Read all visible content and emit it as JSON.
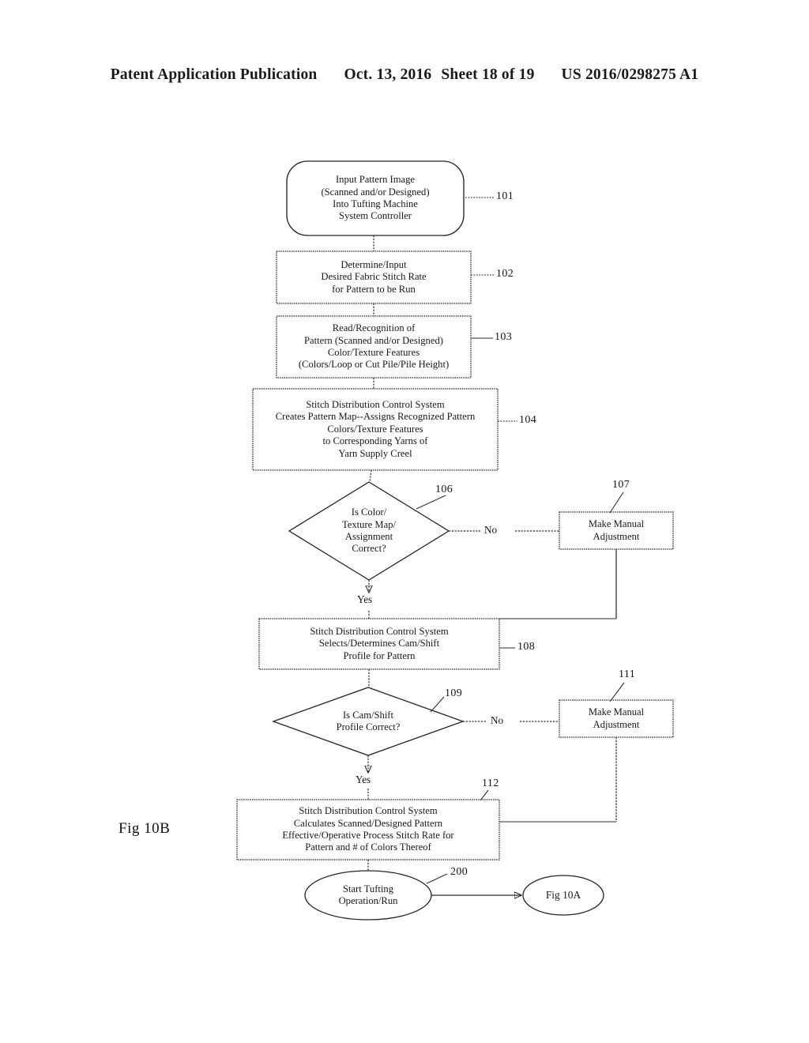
{
  "header": {
    "publication": "Patent Application Publication",
    "date": "Oct. 13, 2016",
    "sheet": "Sheet 18 of 19",
    "patent_number": "US 2016/0298275 A1"
  },
  "figure": {
    "label": "Fig 10B"
  },
  "nodes": [
    {
      "id": "101",
      "shape": "rounded-rect",
      "ref": "101",
      "text": "Input Pattern Image\n(Scanned and/or Designed)\nInto Tufting Machine\nSystem Controller"
    },
    {
      "id": "102",
      "shape": "rect",
      "ref": "102",
      "text": "Determine/Input\nDesired Fabric Stitch Rate\nfor Pattern to be Run"
    },
    {
      "id": "103",
      "shape": "rect",
      "ref": "103",
      "text": "Read/Recognition of\nPattern (Scanned and/or Designed)\nColor/Texture Features\n(Colors/Loop or Cut Pile/Pile Height)"
    },
    {
      "id": "104",
      "shape": "rect",
      "ref": "104",
      "text": "Stitch Distribution Control System\nCreates Pattern Map--Assigns Recognized Pattern\nColors/Texture Features\nto Corresponding Yarns of\nYarn Supply Creel"
    },
    {
      "id": "106",
      "shape": "diamond",
      "ref": "106",
      "text": "Is Color/\nTexture Map/\nAssignment\nCorrect?"
    },
    {
      "id": "107",
      "shape": "rect",
      "ref": "107",
      "text": "Make Manual\nAdjustment"
    },
    {
      "id": "108",
      "shape": "rect",
      "ref": "108",
      "text": "Stitch Distribution Control System\nSelects/Determines Cam/Shift\nProfile for Pattern"
    },
    {
      "id": "109",
      "shape": "diamond",
      "ref": "109",
      "text": "Is Cam/Shift\nProfile Correct?"
    },
    {
      "id": "111",
      "shape": "rect",
      "ref": "111",
      "text": "Make Manual\nAdjustment"
    },
    {
      "id": "112",
      "shape": "rect",
      "ref": "112",
      "text": "Stitch Distribution Control System\nCalculates Scanned/Designed Pattern\nEffective/Operative Process Stitch Rate for\nPattern and # of Colors Thereof"
    },
    {
      "id": "200",
      "shape": "ellipse",
      "ref": "200",
      "text": "Start Tufting\nOperation/Run"
    },
    {
      "id": "fig10a",
      "shape": "ellipse",
      "ref": "",
      "text": "Fig 10A"
    }
  ],
  "edge_labels": {
    "no_106": "No",
    "yes_106": "Yes",
    "no_109": "No",
    "yes_109": "Yes"
  },
  "colors": {
    "ink": "#1a1a1a",
    "line": "#2b2b2b",
    "paper": "#ffffff"
  }
}
